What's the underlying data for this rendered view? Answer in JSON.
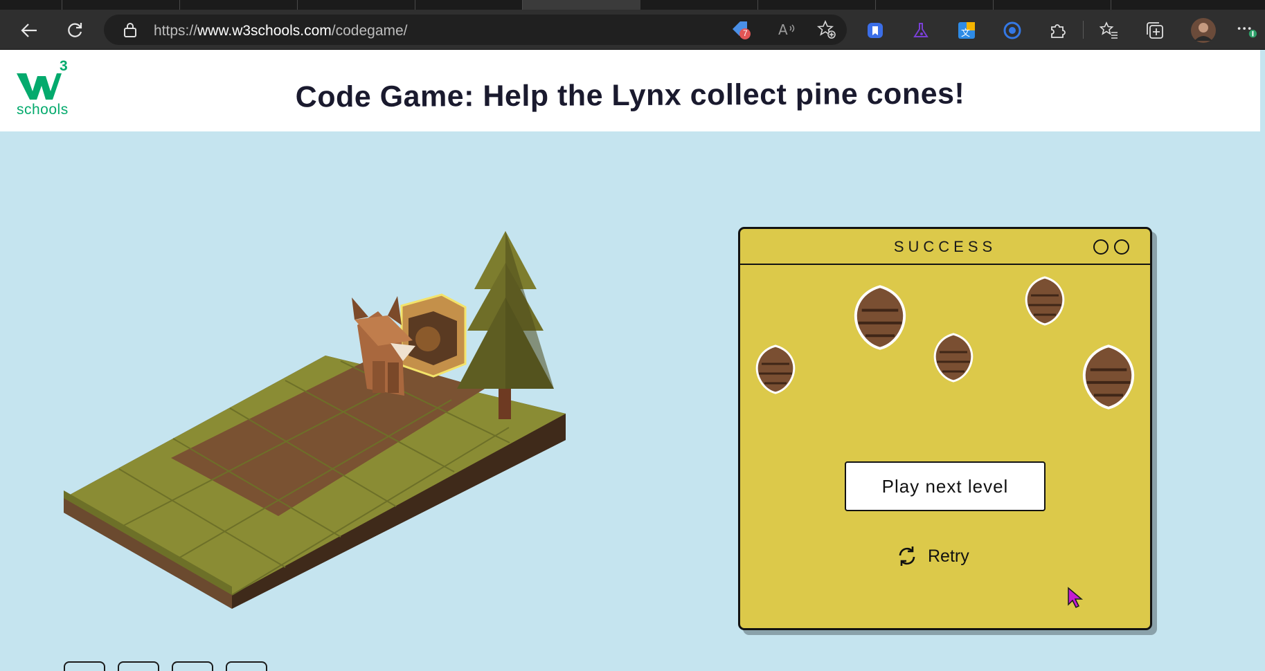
{
  "browser": {
    "url_scheme": "https://",
    "url_host": "www.w3schools.com",
    "url_path": "/codegame/",
    "extension_badge_count": "7"
  },
  "site": {
    "logo_text": "schools",
    "logo_superscript": "3",
    "title": "Code Game: Help the Lynx collect pine cones!"
  },
  "success": {
    "title": "SUCCESS",
    "next_level_label": "Play next level",
    "retry_label": "Retry"
  },
  "colors": {
    "page_background": "#c5e4ef",
    "panel": "#dcc94a",
    "brand": "#04aa6d"
  }
}
